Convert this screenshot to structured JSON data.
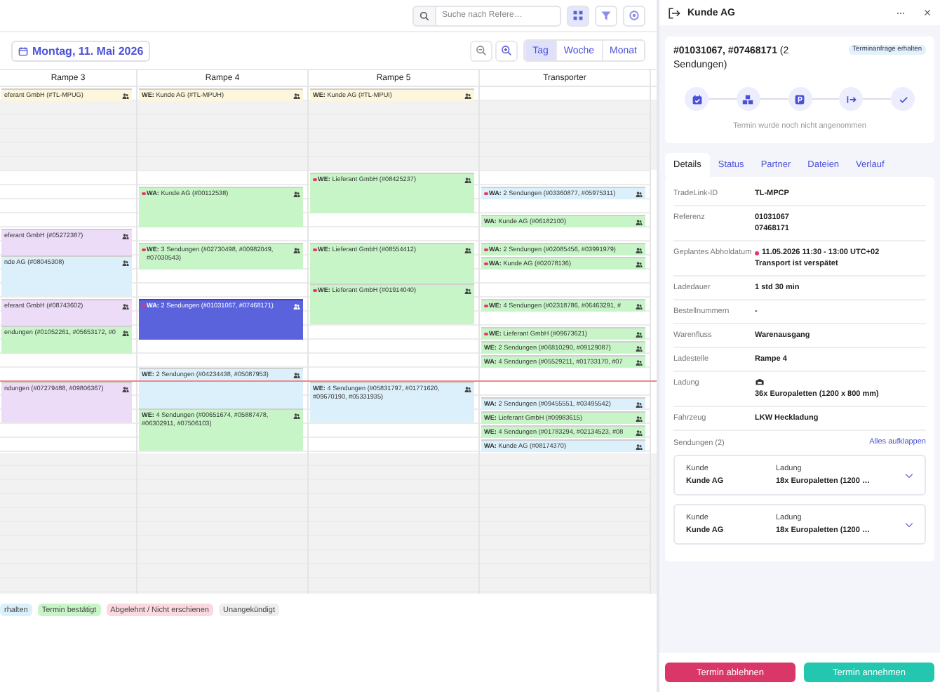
{
  "search": {
    "placeholder": "Suche nach Refere…"
  },
  "date": {
    "label": "Montag, 11. Mai 2026"
  },
  "views": [
    {
      "label": "Tag",
      "selected": true
    },
    {
      "label": "Woche",
      "selected": false
    },
    {
      "label": "Monat",
      "selected": false
    }
  ],
  "columns": [
    {
      "title": "Rampe 3",
      "events": [
        {
          "text": "eferant GmbH (#TL-MPUG)",
          "dot": false,
          "color": "#fbf6dc",
          "selected": false
        },
        {
          "text": "eferant GmbH (#05272387)",
          "dot": false,
          "color": "#ecdcf7",
          "selected": false
        },
        {
          "text": "nde AG (#08045308)",
          "dot": false,
          "color": "#dcf0fb",
          "selected": false
        },
        {
          "text": "eferant GmbH (#08743602)",
          "dot": false,
          "color": "#ecdcf7",
          "selected": false
        },
        {
          "text": "endungen (#01052261, #05653172, #0",
          "dot": false,
          "color": "#c8f5c8",
          "selected": false
        },
        {
          "text": "ndungen (#07279488, #09806367)",
          "dot": false,
          "color": "#ecdcf7",
          "selected": false
        }
      ]
    },
    {
      "title": "Rampe 4",
      "events": [
        {
          "prefix": "WE:",
          "text": "Kunde AG (#TL-MPUH)",
          "dot": false,
          "color": "#fbf6dc",
          "selected": false
        },
        {
          "prefix": "WA:",
          "text": "Kunde AG (#00112538)",
          "dot": true,
          "color": "#c8f5c8",
          "selected": false
        },
        {
          "prefix": "WE:",
          "text": "3 Sendungen (#02730498, #00982049, #07030543)",
          "dot": true,
          "color": "#c8f5c8",
          "selected": false
        },
        {
          "prefix": "WA:",
          "text": "2 Sendungen (#01031067, #07468171)",
          "dot": true,
          "color": "#5a63dc",
          "selected": true
        },
        {
          "prefix": "WE:",
          "text": "2 Sendungen (#04234438, #05087953)",
          "dot": false,
          "color": "#dcf0fb",
          "selected": false
        },
        {
          "prefix": "WE:",
          "text": "4 Sendungen (#00651674, #05887478, #06302911, #07506103)",
          "dot": false,
          "color": "#c8f5c8",
          "selected": false
        }
      ]
    },
    {
      "title": "Rampe 5",
      "events": [
        {
          "prefix": "WE:",
          "text": "Kunde AG (#TL-MPUI)",
          "dot": false,
          "color": "#fbf6dc",
          "selected": false
        },
        {
          "prefix": "WE:",
          "text": "Lieferant GmbH (#08425237)",
          "dot": true,
          "color": "#c8f5c8",
          "selected": false
        },
        {
          "prefix": "WE:",
          "text": "Lieferant GmbH (#08554412)",
          "dot": true,
          "color": "#c8f5c8",
          "selected": false
        },
        {
          "prefix": "WE:",
          "text": "Lieferant GmbH (#01914040)",
          "dot": true,
          "color": "#c8f5c8",
          "selected": false
        },
        {
          "prefix": "WE:",
          "text": "4 Sendungen (#05831797, #01771620, #09670190, #05331935)",
          "dot": false,
          "color": "#dcf0fb",
          "selected": false
        }
      ]
    },
    {
      "title": "Transporter",
      "events": [
        {
          "prefix": "WA:",
          "text": "2 Sendungen (#03360877, #05975311)",
          "dot": true,
          "color": "#dcf0fb",
          "selected": false
        },
        {
          "prefix": "WA:",
          "text": "Kunde AG (#06182100)",
          "dot": false,
          "color": "#c8f5c8",
          "selected": false
        },
        {
          "prefix": "WA:",
          "text": "2 Sendungen (#02085456, #03991979)",
          "dot": true,
          "color": "#c8f5c8",
          "selected": false
        },
        {
          "prefix": "WA:",
          "text": "Kunde AG (#02078136)",
          "dot": true,
          "color": "#c8f5c8",
          "selected": false
        },
        {
          "prefix": "WE:",
          "text": "4 Sendungen (#02318786, #06463291, #",
          "dot": true,
          "color": "#c8f5c8",
          "selected": false
        },
        {
          "prefix": "WE:",
          "text": "Lieferant GmbH (#09673621)",
          "dot": true,
          "color": "#c8f5c8",
          "selected": false
        },
        {
          "prefix": "WE:",
          "text": "2 Sendungen (#06810290, #09129087)",
          "dot": false,
          "color": "#c8f5c8",
          "selected": false
        },
        {
          "prefix": "WA:",
          "text": "4 Sendungen (#05529211, #01733170, #07",
          "dot": false,
          "color": "#c8f5c8",
          "selected": false
        },
        {
          "prefix": "WA:",
          "text": "2 Sendungen (#09455551, #03495542)",
          "dot": false,
          "color": "#dcf0fb",
          "selected": false
        },
        {
          "prefix": "WE:",
          "text": "Lieferant GmbH (#09983615)",
          "dot": false,
          "color": "#c8f5c8",
          "selected": false
        },
        {
          "prefix": "WE:",
          "text": "4 Sendungen (#01783294, #02134523, #08",
          "dot": false,
          "color": "#c8f5c8",
          "selected": false
        },
        {
          "prefix": "WA:",
          "text": "Kunde AG (#08174370)",
          "dot": false,
          "color": "#dcf0fb",
          "selected": false
        }
      ]
    }
  ],
  "legend": [
    {
      "label": "rhalten",
      "color": "#dcf0fb"
    },
    {
      "label": "Termin bestätigt",
      "color": "#c8f5c8"
    },
    {
      "label": "Abgelehnt / Nicht erschienen",
      "color": "#fbd9e0"
    },
    {
      "label": "Unangekündigt",
      "color": "#eeeeee"
    }
  ],
  "panel": {
    "title": "Kunde AG",
    "heading": "**#01031067, #07468171** (2 Sendungen)",
    "badge": "Terminanfrage erhalten",
    "steps": [
      {
        "kind": "calendar"
      },
      {
        "kind": "boxes"
      },
      {
        "kind": "parking"
      },
      {
        "kind": "exit"
      },
      {
        "kind": "check"
      }
    ],
    "step_note": "Termin wurde noch nicht angenommen",
    "tabs": [
      {
        "label": "Details",
        "selected": true
      },
      {
        "label": "Status",
        "selected": false
      },
      {
        "label": "Partner",
        "selected": false
      },
      {
        "label": "Dateien",
        "selected": false
      },
      {
        "label": "Verlauf",
        "selected": false
      }
    ],
    "details": [
      {
        "label": "TradeLink-ID",
        "lines": [
          "TL-MPCP"
        ],
        "kind": "text"
      },
      {
        "label": "Referenz",
        "lines": [
          "01031067",
          "07468171"
        ],
        "kind": "text"
      },
      {
        "label": "Geplantes Abholdatum",
        "lines": [
          "11.05.2026 11:30 - 13:00 UTC+02",
          "Transport ist verspätet"
        ],
        "kind": "alert"
      },
      {
        "label": "Ladedauer",
        "lines": [
          "1 std 30 min"
        ],
        "kind": "text"
      },
      {
        "label": "Bestellnummern",
        "lines": [
          "-"
        ],
        "kind": "text"
      },
      {
        "label": "Warenfluss",
        "lines": [
          "Warenausgang"
        ],
        "kind": "text"
      },
      {
        "label": "Ladestelle",
        "lines": [
          "Rampe 4"
        ],
        "kind": "text"
      },
      {
        "label": "Ladung",
        "lines": [
          "36x Europaletten (1200 x 800 mm)"
        ],
        "kind": "cargo"
      },
      {
        "label": "Fahrzeug",
        "lines": [
          "LKW Heckladung"
        ],
        "kind": "text"
      }
    ],
    "shipments_label": "Sendungen (2)",
    "expand_all": "Alles aufklappen",
    "shipments": [
      {
        "k1": "Kunde",
        "v1": "Kunde AG",
        "k2": "Ladung",
        "v2": "18x Europaletten (1200 …"
      },
      {
        "k1": "Kunde",
        "v1": "Kunde AG",
        "k2": "Ladung",
        "v2": "18x Europaletten (1200 …"
      }
    ],
    "reject": "Termin ablehnen",
    "accept": "Termin annehmen"
  }
}
